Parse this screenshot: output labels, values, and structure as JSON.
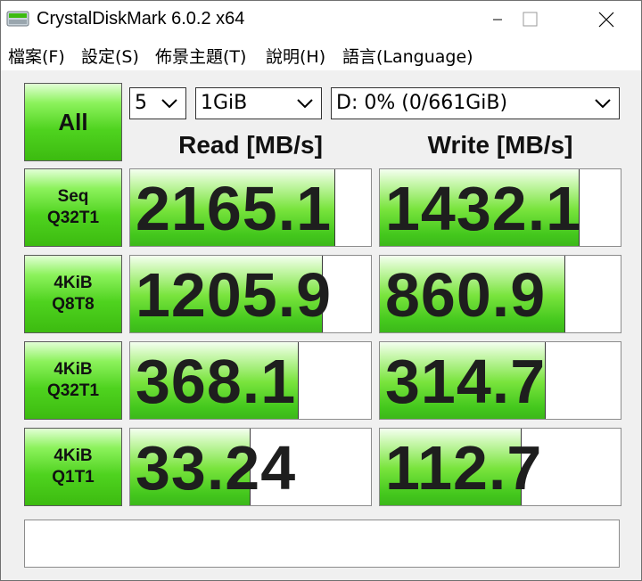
{
  "window": {
    "title": "CrystalDiskMark 6.0.2 x64",
    "accent": "#44c81d"
  },
  "window_controls": {
    "minimize_icon": "minimize-icon",
    "maximize_icon": "maximize-icon",
    "close_icon": "close-icon"
  },
  "menu": {
    "items": [
      "檔案(F)",
      "設定(S)",
      "佈景主題(T)",
      "說明(H)",
      "語言(Language)"
    ]
  },
  "controls": {
    "all_label": "All",
    "count": "5",
    "size": "1GiB",
    "drive": "D: 0% (0/661GiB)"
  },
  "columns": {
    "read": "Read [MB/s]",
    "write": "Write [MB/s]"
  },
  "tests": [
    {
      "label": "Seq\nQ32T1",
      "read": "2165.1",
      "write": "1432.1",
      "read_fill": 0.85,
      "write_fill": 0.83
    },
    {
      "label": "4KiB\nQ8T8",
      "read": "1205.9",
      "write": "860.9",
      "read_fill": 0.8,
      "write_fill": 0.77
    },
    {
      "label": "4KiB\nQ32T1",
      "read": "368.1",
      "write": "314.7",
      "read_fill": 0.7,
      "write_fill": 0.69
    },
    {
      "label": "4KiB\nQ1T1",
      "read": "33.24",
      "write": "112.7",
      "read_fill": 0.5,
      "write_fill": 0.59
    }
  ],
  "comment": ""
}
